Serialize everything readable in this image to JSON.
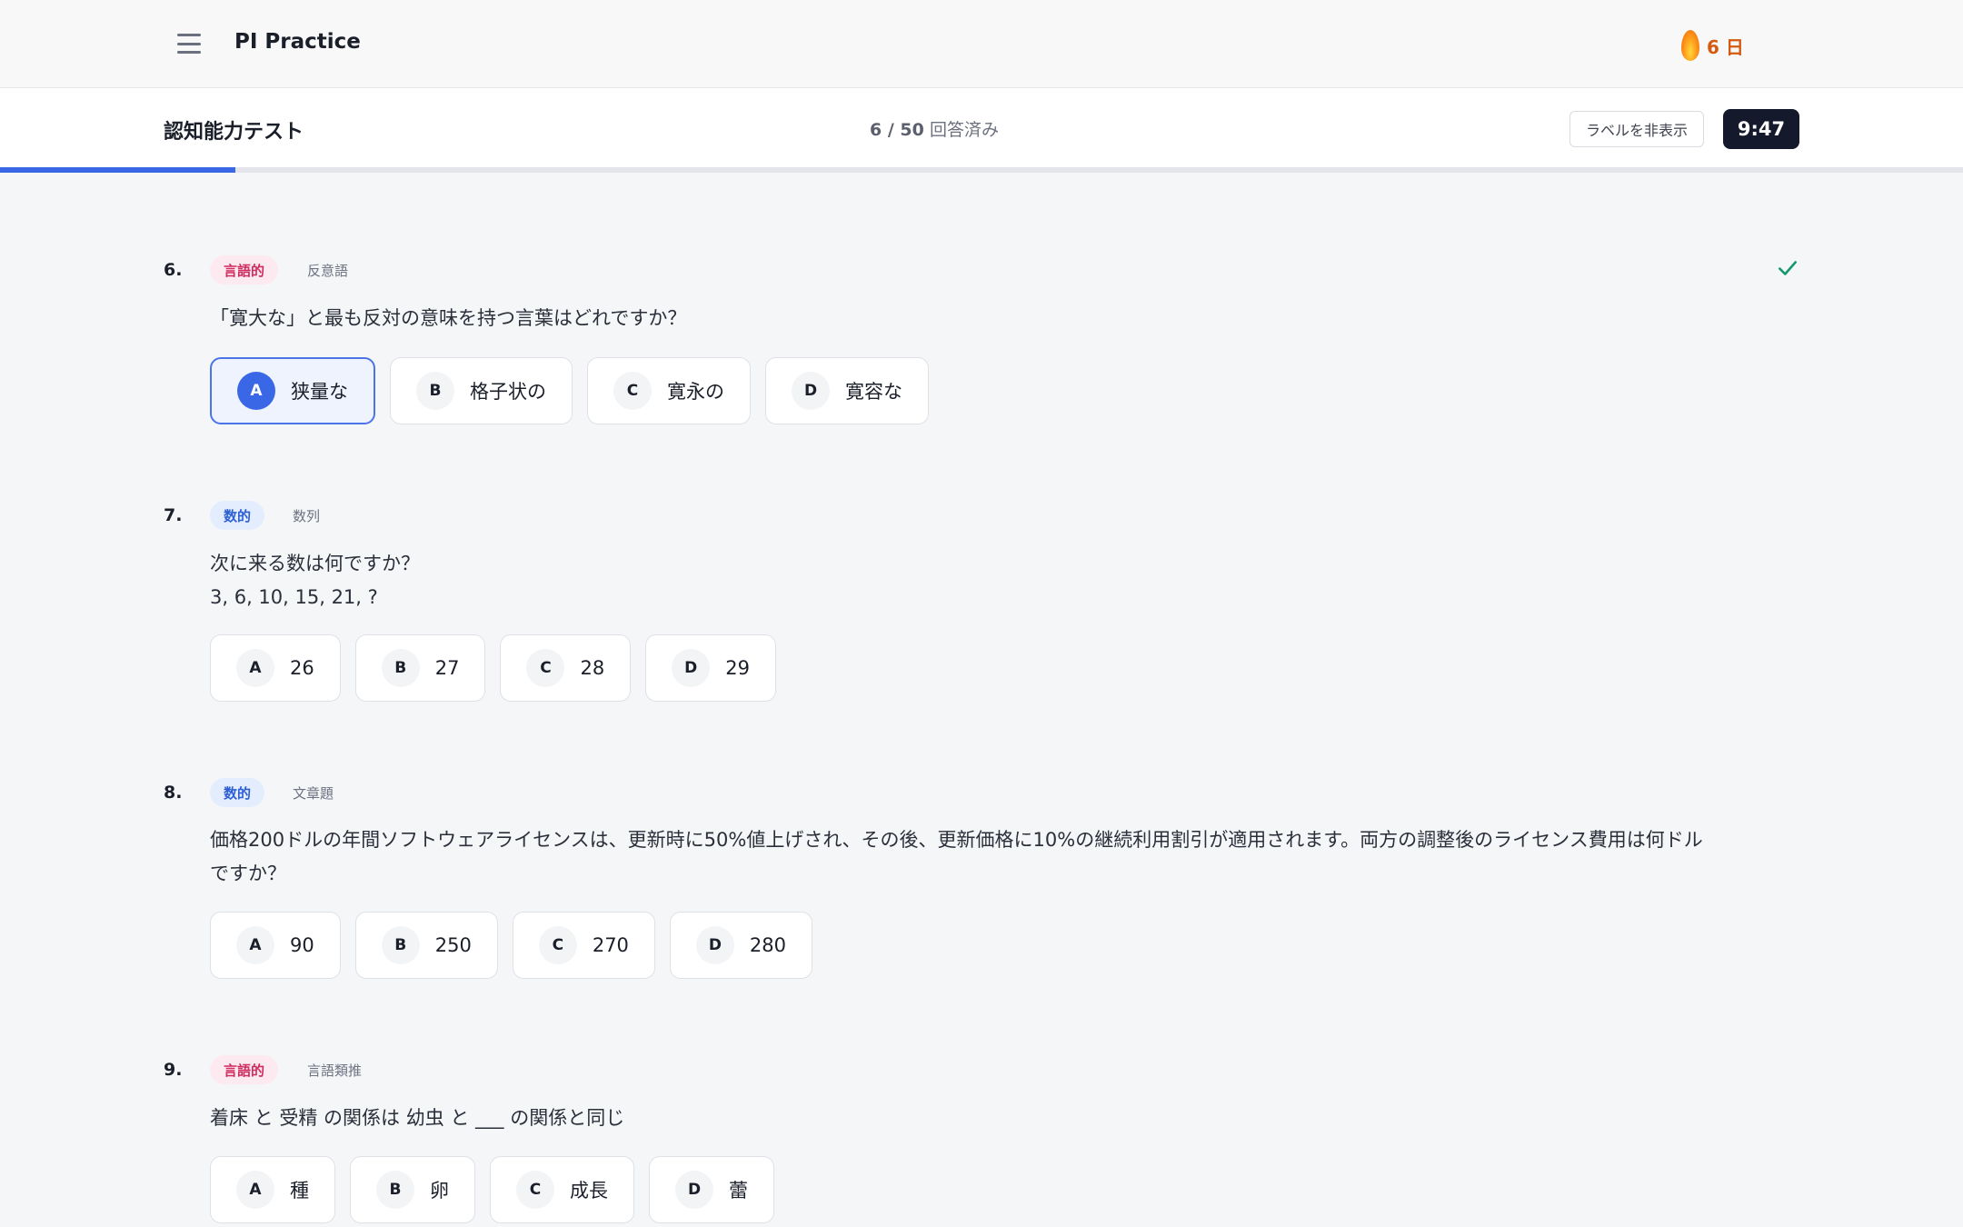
{
  "app": {
    "title": "PI Practice",
    "streak": "6 日"
  },
  "test": {
    "title": "認知能力テスト",
    "answered_count": "6 / 50",
    "answered_suffix": "回答済み",
    "hide_labels": "ラベルを非表示",
    "timer": "9:47",
    "progress": 0.12
  },
  "questions": [
    {
      "number": "6.",
      "category": "言語的",
      "subcategory": "反意語",
      "answered": true,
      "text": "「寛大な」と最も反対の意味を持つ言葉はどれですか？",
      "options": [
        {
          "letter": "A",
          "text": "狭量な",
          "selected": true
        },
        {
          "letter": "B",
          "text": "格子状の"
        },
        {
          "letter": "C",
          "text": "寛永の"
        },
        {
          "letter": "D",
          "text": "寛容な"
        }
      ]
    },
    {
      "number": "7.",
      "category": "数的",
      "subcategory": "数列",
      "text": "次に来る数は何ですか？",
      "text2": "3, 6, 10, 15, 21, ?",
      "options": [
        {
          "letter": "A",
          "text": "26"
        },
        {
          "letter": "B",
          "text": "27"
        },
        {
          "letter": "C",
          "text": "28"
        },
        {
          "letter": "D",
          "text": "29"
        }
      ]
    },
    {
      "number": "8.",
      "category": "数的",
      "subcategory": "文章題",
      "text": "価格200ドルの年間ソフトウェアライセンスは、更新時に50%値上げされ、その後、更新価格に10%の継続利用割引が適用されます。両方の調整後のライセンス費用は何ドル",
      "text2": "ですか？",
      "options": [
        {
          "letter": "A",
          "text": "90"
        },
        {
          "letter": "B",
          "text": "250"
        },
        {
          "letter": "C",
          "text": "270"
        },
        {
          "letter": "D",
          "text": "280"
        }
      ]
    },
    {
      "number": "9.",
      "category": "言語的",
      "subcategory": "言語類推",
      "text": "着床 と 受精 の関係は 幼虫 と ___ の関係と同じ",
      "options": [
        {
          "letter": "A",
          "text": "種"
        },
        {
          "letter": "B",
          "text": "卵"
        },
        {
          "letter": "C",
          "text": "成長"
        },
        {
          "letter": "D",
          "text": "蕾"
        }
      ]
    }
  ]
}
